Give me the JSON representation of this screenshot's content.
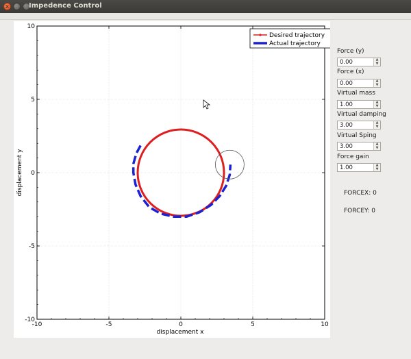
{
  "window": {
    "title": "Impedence Control"
  },
  "plot": {
    "legend": {
      "desired": "Desired trajectory",
      "actual": "Actual trajectory"
    },
    "xlabel": "displacement x",
    "ylabel": "displacement y",
    "x_ticks": [
      "-10",
      "-5",
      "0",
      "5",
      "10"
    ],
    "y_ticks": [
      "10",
      "5",
      "0",
      "-5",
      "-10"
    ]
  },
  "chart_data": {
    "type": "line",
    "xlim": [
      -10,
      10
    ],
    "ylim": [
      -10,
      10
    ],
    "grid": true,
    "legend_position": "top-right",
    "series": [
      {
        "name": "Desired trajectory",
        "color": "#dd1f1f",
        "style": "solid",
        "shape": "circle",
        "center": [
          0,
          0
        ],
        "radius": 3
      },
      {
        "name": "Actual trajectory",
        "color": "#1a22d2",
        "style": "dashed",
        "points": [
          [
            -2.8,
            1.85
          ],
          [
            -3.1,
            1.3
          ],
          [
            -3.3,
            0.6
          ],
          [
            -3.3,
            0.0
          ],
          [
            -3.15,
            -0.8
          ],
          [
            -2.8,
            -1.6
          ],
          [
            -2.2,
            -2.35
          ],
          [
            -1.4,
            -2.8
          ],
          [
            -0.5,
            -3.0
          ],
          [
            0.4,
            -3.0
          ],
          [
            1.3,
            -2.7
          ],
          [
            2.1,
            -2.2
          ],
          [
            2.7,
            -1.6
          ],
          [
            3.15,
            -0.9
          ],
          [
            3.4,
            -0.15
          ],
          [
            3.45,
            0.55
          ]
        ]
      }
    ],
    "cursor_circle": {
      "center": [
        3.4,
        0.55
      ],
      "radius": 1.0
    }
  },
  "controls": [
    {
      "label": "Force (y)",
      "value": "0.00"
    },
    {
      "label": "Force (x)",
      "value": "0.00"
    },
    {
      "label": "Virtual mass",
      "value": "1.00"
    },
    {
      "label": "Virtual damping",
      "value": "3.00"
    },
    {
      "label": "Virtual Sping",
      "value": "3.00"
    },
    {
      "label": "Force gain",
      "value": "1.00"
    }
  ],
  "readouts": {
    "forcex": "FORCEX: 0",
    "forcey": "FORCEY: 0"
  },
  "icons": {
    "close": "close-icon",
    "minimize": "minimize-icon",
    "maximize": "maximize-icon",
    "cursor": "mouse-cursor-icon"
  }
}
